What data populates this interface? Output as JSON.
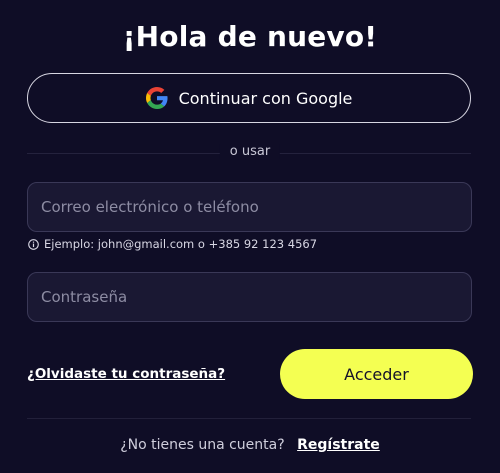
{
  "login": {
    "title": "¡Hola de nuevo!",
    "google_button_label": "Continuar con Google",
    "divider_text": "o usar",
    "email_placeholder": "Correo electrónico o teléfono",
    "email_value": "",
    "email_hint": "Ejemplo: john@gmail.com o +385 92 123 4567",
    "password_placeholder": "Contraseña",
    "password_value": "",
    "forgot_password_label": "¿Olvidaste tu contraseña?",
    "submit_label": "Acceder",
    "no_account_text": "¿No tienes una cuenta?",
    "signup_label": "Regístrate"
  },
  "icons": {
    "google": "google-icon",
    "hint": "info-icon"
  },
  "colors": {
    "background": "#0f0d26",
    "accent": "#f4ff52",
    "field_background": "#1a1833",
    "field_border": "#3a3857"
  }
}
